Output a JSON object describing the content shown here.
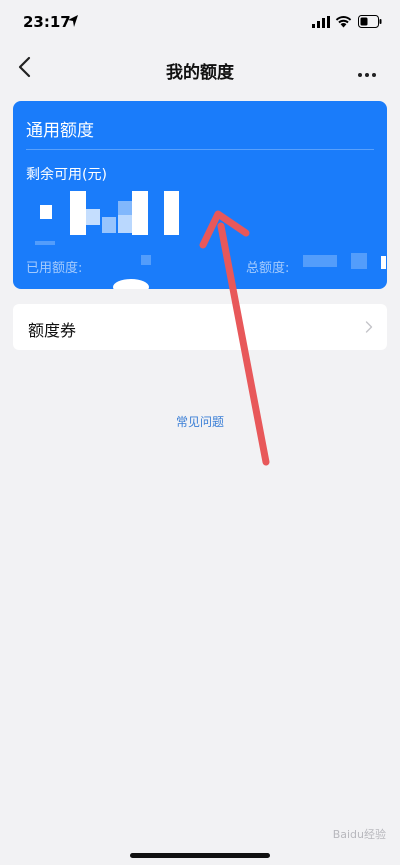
{
  "status_bar": {
    "time": "23:17"
  },
  "nav": {
    "title": "我的额度",
    "back_icon": "chevron-left-icon",
    "more_icon": "ellipsis-icon"
  },
  "card": {
    "title": "通用额度",
    "remaining_label": "剩余可用(元)",
    "used_label": "已用额度:",
    "total_label": "总额度:",
    "background_color": "#1a7cfa"
  },
  "coupon_row": {
    "label": "额度券",
    "chevron_icon": "chevron-right-icon"
  },
  "faq": {
    "label": "常见问题",
    "color": "#3b7fd6"
  },
  "annotation": {
    "arrow_color": "#e8585a"
  },
  "watermark": {
    "text": "Baidu经验"
  }
}
